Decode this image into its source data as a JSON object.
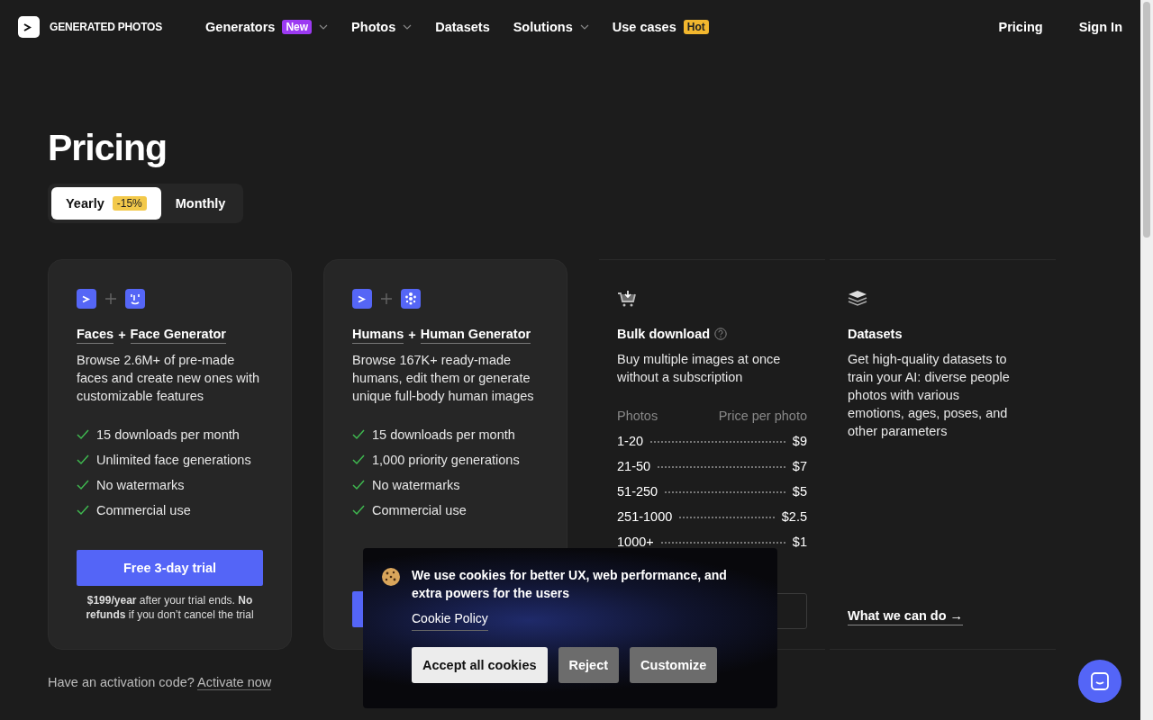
{
  "nav": {
    "logo": "GENERATED PHOTOS",
    "items": [
      {
        "label": "Generators",
        "badge": "New",
        "color": "#9c3af2",
        "dropdown": true
      },
      {
        "label": "Photos",
        "dropdown": true
      },
      {
        "label": "Datasets",
        "dropdown": false
      },
      {
        "label": "Solutions",
        "dropdown": true
      },
      {
        "label": "Use cases",
        "badge": "Hot",
        "color": "#f2b72e",
        "dropdown": false
      }
    ],
    "right": [
      "Pricing",
      "Sign In"
    ]
  },
  "heading": "Pricing",
  "billing": [
    {
      "label": "Yearly",
      "badge": "-15%",
      "selected": true
    },
    {
      "label": "Monthly",
      "selected": false
    }
  ],
  "cards": [
    {
      "kind": "plan",
      "title": [
        "Faces",
        "Face Generator"
      ],
      "joiner": "+",
      "description": "Browse 2.6M+ of pre-made faces and create new ones with customizable features",
      "features": [
        "15 downloads per month",
        "Unlimited face generations",
        "No watermarks",
        "Commercial use"
      ],
      "button": "Free 3-day trial",
      "note": "**$199/year** after your trial ends. **No refunds** if you don’t cancel the trial"
    },
    {
      "kind": "plan",
      "title": [
        "Humans",
        "Human Generator"
      ],
      "joiner": "+",
      "description": "Browse 167K+ ready-made humans, edit them or generate unique full-body human images",
      "features": [
        "15 downloads per month",
        "1,000 priority generations",
        "No watermarks",
        "Commercial use"
      ]
    },
    {
      "kind": "bulk",
      "title": "Bulk download",
      "description": "Buy multiple images at once without a subscription",
      "columns": [
        "Photos",
        "Price per photo"
      ],
      "rows": [
        [
          "1-20",
          "$9"
        ],
        [
          "21-50",
          "$7"
        ],
        [
          "51-250",
          "$5"
        ],
        [
          "251-1000",
          "$2.5"
        ],
        [
          "1000+",
          "$1"
        ]
      ]
    },
    {
      "kind": "info",
      "title": "Datasets",
      "description": "Get high-quality datasets to train your AI: diverse people photos with various emotions, ages, poses, and other parameters",
      "link": "What we can do →"
    }
  ],
  "activation": {
    "text": "Have an activation code?",
    "link": "Activate now"
  },
  "cookie_banner": {
    "message": "We use cookies for better UX, web performance, and extra powers for the users",
    "policy_link": "Cookie Policy",
    "buttons": [
      "Accept all cookies",
      "Reject",
      "Customize"
    ]
  }
}
